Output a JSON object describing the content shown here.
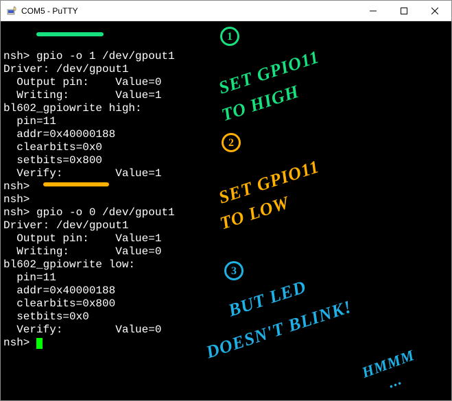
{
  "window": {
    "title": "COM5 - PuTTY"
  },
  "terminal": {
    "lines": [
      "nsh> gpio -o 1 /dev/gpout1",
      "Driver: /dev/gpout1",
      "  Output pin:    Value=0",
      "  Writing:       Value=1",
      "bl602_gpiowrite high:",
      "  pin=11",
      "  addr=0x40000188",
      "  clearbits=0x0",
      "  setbits=0x800",
      "  Verify:        Value=1",
      "nsh>",
      "nsh>",
      "nsh> gpio -o 0 /dev/gpout1",
      "Driver: /dev/gpout1",
      "  Output pin:    Value=1",
      "  Writing:       Value=0",
      "bl602_gpiowrite low:",
      "  pin=11",
      "  addr=0x40000188",
      "  clearbits=0x800",
      "  setbits=0x0",
      "  Verify:        Value=0"
    ],
    "prompt": "nsh> "
  },
  "annotations": {
    "num1": "1",
    "num2": "2",
    "num3": "3",
    "note1a": "SET GPIO11",
    "note1b": "TO HIGH",
    "note2a": "SET GPIO11",
    "note2b": "TO LOW",
    "note3a": "BUT LED",
    "note3b": "DOESN'T BLINK!",
    "hmmm": "HMMM",
    "dots": "..."
  }
}
